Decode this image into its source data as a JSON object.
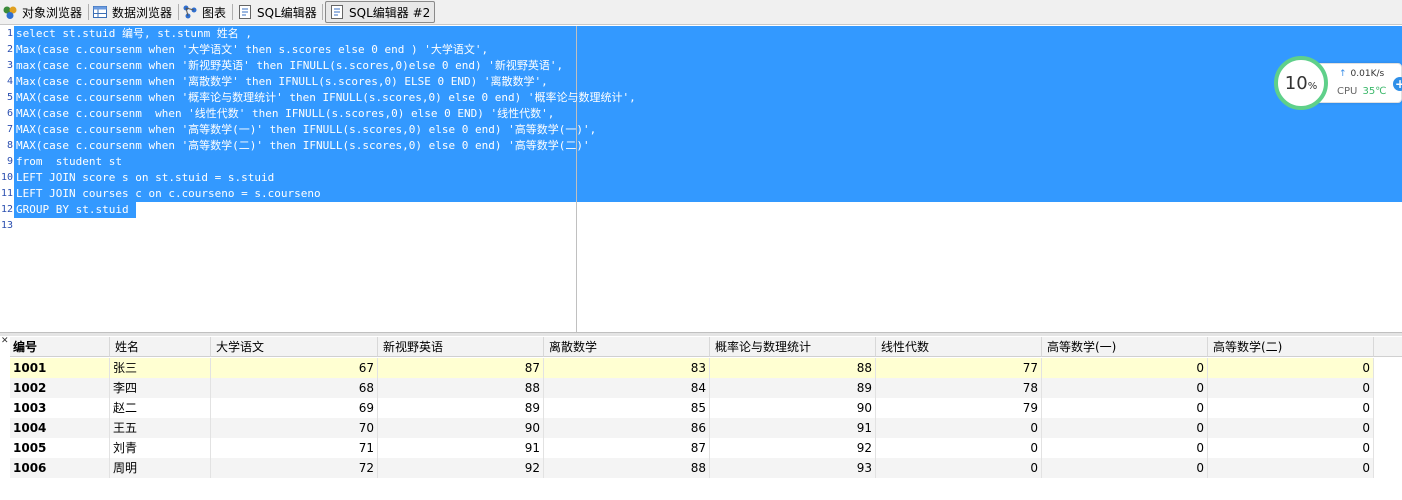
{
  "toolbar": {
    "tabs": [
      {
        "label": "对象浏览器",
        "icon": "object-browser-icon"
      },
      {
        "label": "数据浏览器",
        "icon": "data-browser-icon"
      },
      {
        "label": "图表",
        "icon": "chart-icon"
      },
      {
        "label": "SQL编辑器",
        "icon": "sql-editor-icon"
      },
      {
        "label": "SQL编辑器 #2",
        "icon": "sql-editor-icon",
        "active": true
      }
    ]
  },
  "editor": {
    "line_numbers": [
      "1",
      "2",
      "3",
      "4",
      "5",
      "6",
      "7",
      "8",
      "9",
      "10",
      "11",
      "12",
      "13"
    ],
    "lines": [
      "select st.stuid 编号, st.stunm 姓名 ,",
      "Max(case c.coursenm when '大学语文' then s.scores else 0 end ) '大学语文',",
      "max(case c.coursenm when '新视野英语' then IFNULL(s.scores,0)else 0 end) '新视野英语',",
      "Max(case c.coursenm when '离散数学' then IFNULL(s.scores,0) ELSE 0 END) '离散数学',",
      "MAX(case c.coursenm when '概率论与数理统计' then IFNULL(s.scores,0) else 0 end) '概率论与数理统计',",
      "MAX(case c.coursenm  when '线性代数' then IFNULL(s.scores,0) else 0 END) '线性代数',",
      "MAX(case c.coursenm when '高等数学(一)' then IFNULL(s.scores,0) else 0 end) '高等数学(一)',",
      "MAX(case c.coursenm when '高等数学(二)' then IFNULL(s.scores,0) else 0 end) '高等数学(二)'",
      "from  student st",
      "LEFT JOIN score s on st.stuid = s.stuid",
      "LEFT JOIN courses c on c.courseno = s.courseno",
      "GROUP BY st.stuid",
      ""
    ]
  },
  "monitor": {
    "percent": "10",
    "percent_unit": "%",
    "net_speed": "0.01K/s",
    "cpu_label": "CPU",
    "cpu_temp": "35℃"
  },
  "results": {
    "close_glyph": "✕",
    "columns": [
      "编号",
      "姓名",
      "大学语文",
      "新视野英语",
      "离散数学",
      "概率论与数理统计",
      "线性代数",
      "高等数学(一)",
      "高等数学(二)"
    ],
    "rows": [
      [
        "1001",
        "张三",
        "67",
        "87",
        "83",
        "88",
        "77",
        "0",
        "0"
      ],
      [
        "1002",
        "李四",
        "68",
        "88",
        "84",
        "89",
        "78",
        "0",
        "0"
      ],
      [
        "1003",
        "赵二",
        "69",
        "89",
        "85",
        "90",
        "79",
        "0",
        "0"
      ],
      [
        "1004",
        "王五",
        "70",
        "90",
        "86",
        "91",
        "0",
        "0",
        "0"
      ],
      [
        "1005",
        "刘青",
        "71",
        "91",
        "87",
        "92",
        "0",
        "0",
        "0"
      ],
      [
        "1006",
        "周明",
        "72",
        "92",
        "88",
        "93",
        "0",
        "0",
        "0"
      ]
    ]
  }
}
